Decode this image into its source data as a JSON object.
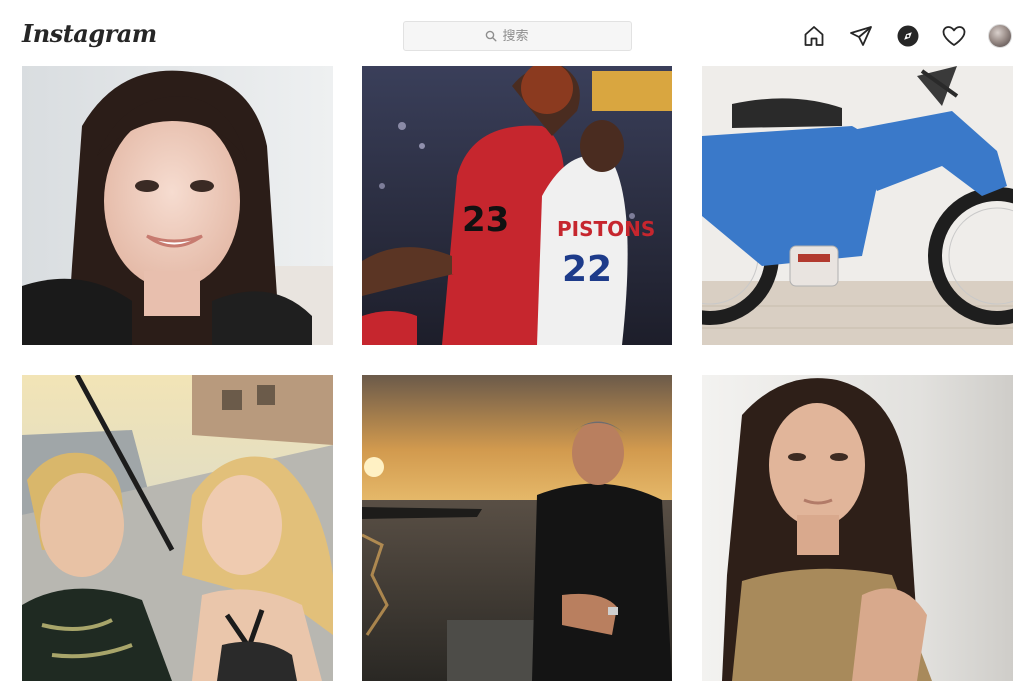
{
  "header": {
    "logo": "Instagram",
    "search_placeholder": "搜索",
    "nav_icons": [
      "home-icon",
      "direct-icon",
      "explore-icon",
      "activity-heart-icon",
      "profile-avatar"
    ]
  },
  "explore_grid": {
    "rows": 2,
    "columns": 3,
    "posts": [
      {
        "subject": "smiling-woman-portrait"
      },
      {
        "subject": "basketball-players"
      },
      {
        "subject": "blue-moped"
      },
      {
        "subject": "couple-selfie"
      },
      {
        "subject": "man-at-sunset-seaside"
      },
      {
        "subject": "woman-portrait"
      }
    ]
  },
  "colors": {
    "text_primary": "#262626",
    "search_bg": "#f6f6f6",
    "search_border": "#e2e2e2",
    "placeholder": "#8e8e8e",
    "page_bg": "#ffffff"
  }
}
